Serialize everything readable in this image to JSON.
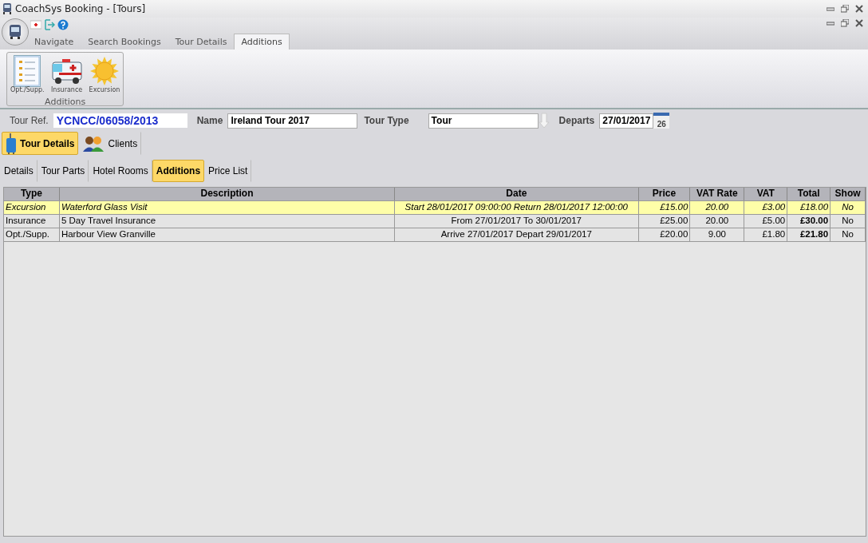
{
  "window": {
    "title": "CoachSys Booking - [Tours]"
  },
  "ribbon": {
    "tabs": [
      {
        "label": "Navigate",
        "selected": false
      },
      {
        "label": "Search Bookings",
        "selected": false
      },
      {
        "label": "Tour Details",
        "selected": false
      },
      {
        "label": "Additions",
        "selected": true
      }
    ],
    "group": {
      "label": "Additions",
      "buttons": [
        {
          "label": "Opt./Supp.",
          "kind": "list",
          "selected": true
        },
        {
          "label": "Insurance",
          "kind": "ambulance",
          "selected": false
        },
        {
          "label": "Excursion",
          "kind": "sun",
          "selected": false
        }
      ]
    }
  },
  "form": {
    "tour_ref_label": "Tour Ref.",
    "tour_ref": "YCNCC/06058/2013",
    "name_label": "Name",
    "name": "Ireland Tour 2017",
    "type_label": "Tour Type",
    "type": "Tour",
    "departs_label": "Departs",
    "departs": "27/01/2017",
    "calendar_day": "26"
  },
  "main_tabs": [
    {
      "label": "Tour Details",
      "kind": "suitcase",
      "selected": true
    },
    {
      "label": "Clients",
      "kind": "people",
      "selected": false
    }
  ],
  "sub_tabs": [
    {
      "label": "Details",
      "selected": false
    },
    {
      "label": "Tour Parts",
      "selected": false
    },
    {
      "label": "Hotel Rooms",
      "selected": false
    },
    {
      "label": "Additions",
      "selected": true
    },
    {
      "label": "Price List",
      "selected": false
    }
  ],
  "table": {
    "columns": [
      "Type",
      "Description",
      "Date",
      "Price",
      "VAT Rate",
      "VAT",
      "Total",
      "Show"
    ],
    "rows": [
      {
        "selected": true,
        "cells": [
          "Excursion",
          "Waterford Glass Visit",
          "Start 28/01/2017 09:00:00 Return 28/01/2017 12:00:00",
          "£15.00",
          "20.00",
          "£3.00",
          "£18.00",
          "No"
        ]
      },
      {
        "selected": false,
        "cells": [
          "Insurance",
          "5 Day Travel Insurance",
          "From 27/01/2017 To 30/01/2017",
          "£25.00",
          "20.00",
          "£5.00",
          "£30.00",
          "No"
        ]
      },
      {
        "selected": false,
        "cells": [
          "Opt./Supp.",
          "Harbour View Granville",
          "Arrive 27/01/2017 Depart 29/01/2017",
          "£20.00",
          "9.00",
          "£1.80",
          "£21.80",
          "No"
        ]
      }
    ]
  }
}
